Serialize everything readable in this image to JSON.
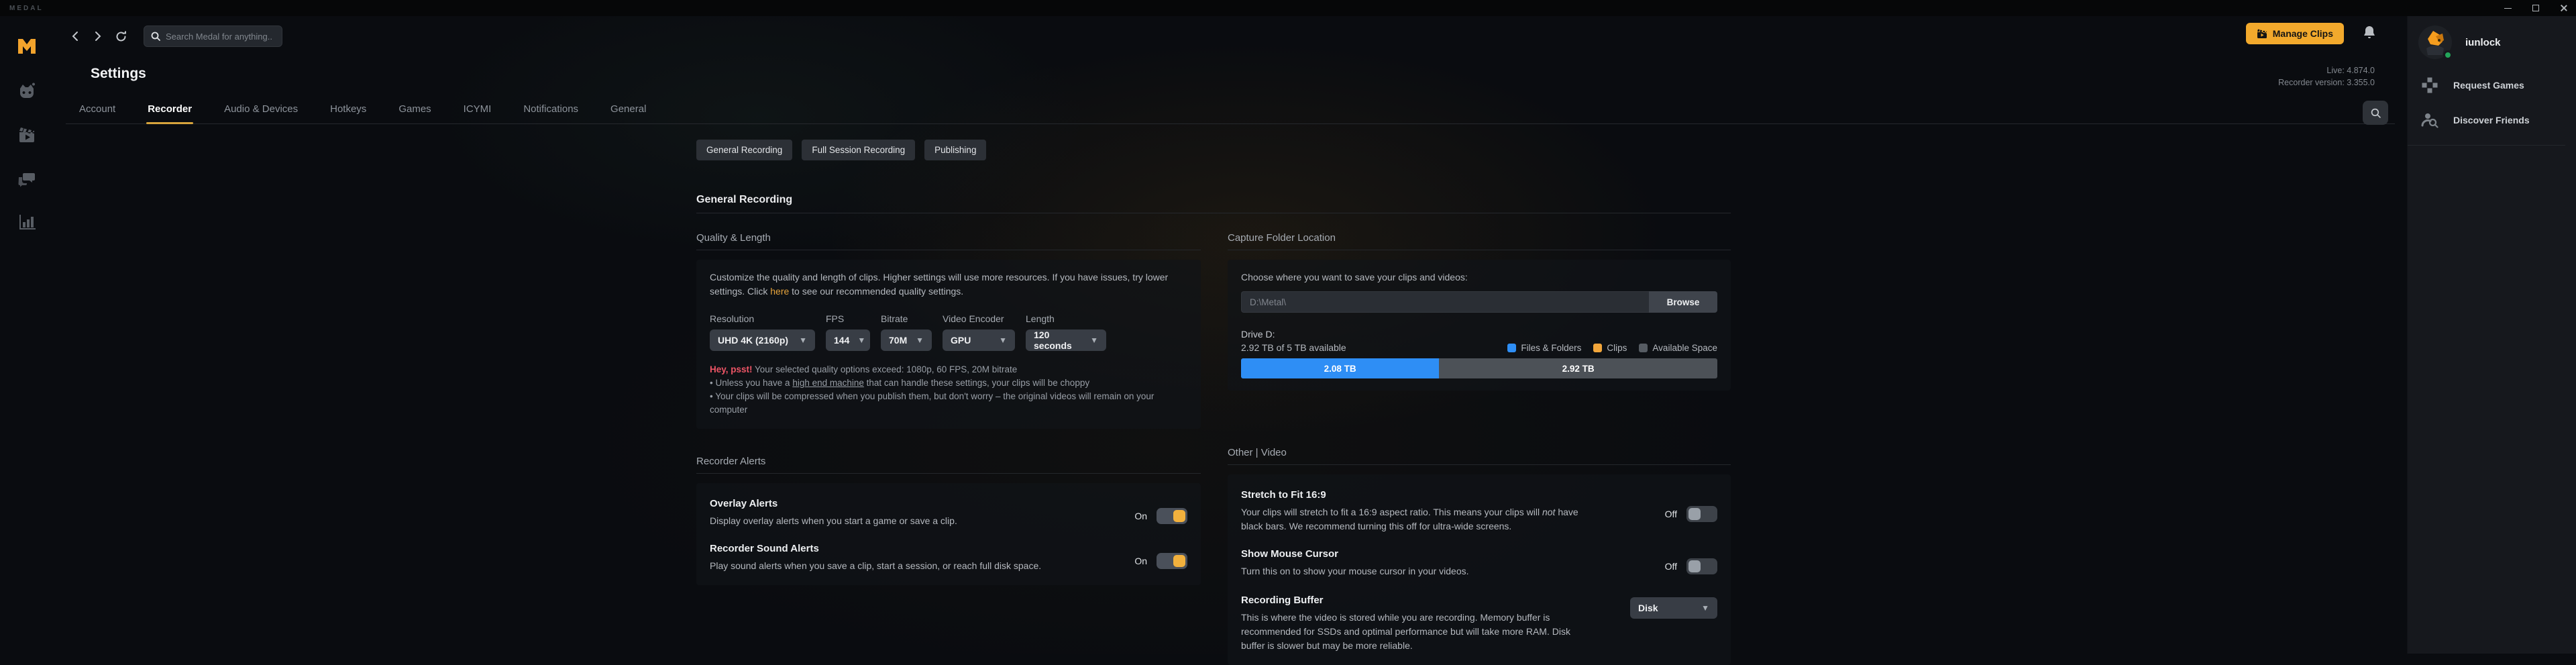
{
  "window": {
    "title": "MEDAL"
  },
  "topbar": {
    "search_placeholder": "Search Medal for anything...",
    "manage_clips_label": "Manage Clips",
    "live_version": "Live: 4.874.0",
    "recorder_version": "Recorder version: 3.355.0"
  },
  "user_panel": {
    "username": "iunlock",
    "request_games": "Request Games",
    "discover_friends": "Discover Friends"
  },
  "settings": {
    "title": "Settings",
    "tabs": [
      {
        "label": "Account"
      },
      {
        "label": "Recorder"
      },
      {
        "label": "Audio & Devices"
      },
      {
        "label": "Hotkeys"
      },
      {
        "label": "Games"
      },
      {
        "label": "ICYMI"
      },
      {
        "label": "Notifications"
      },
      {
        "label": "General"
      }
    ],
    "active_tab": "Recorder"
  },
  "subtabs": [
    {
      "label": "General Recording"
    },
    {
      "label": "Full Session Recording"
    },
    {
      "label": "Publishing"
    }
  ],
  "section_heading": "General Recording",
  "quality": {
    "heading": "Quality & Length",
    "desc_pre": "Customize the quality and length of clips. Higher settings will use more resources. If you have issues, try lower settings. Click ",
    "desc_link": "here",
    "desc_post": " to see our recommended quality settings.",
    "dropdowns": [
      {
        "label": "Resolution",
        "value": "UHD 4K (2160p)"
      },
      {
        "label": "FPS",
        "value": "144"
      },
      {
        "label": "Bitrate",
        "value": "70M"
      },
      {
        "label": "Video Encoder",
        "value": "GPU"
      },
      {
        "label": "Length",
        "value": "120 seconds"
      }
    ],
    "warning": {
      "lead": "Hey, psst!",
      "text": " Your selected quality options exceed: 1080p, 60 FPS, 20M bitrate",
      "bullet1_pre": "Unless you have a ",
      "bullet1_link": "high end machine",
      "bullet1_post": " that can handle these settings, your clips will be choppy",
      "bullet2": "Your clips will be compressed when you publish them, but don't worry – the original videos will remain on your computer"
    }
  },
  "capture": {
    "heading": "Capture Folder Location",
    "choose_label": "Choose where you want to save your clips and videos:",
    "path": "D:\\Metal\\",
    "browse_label": "Browse",
    "drive_label": "Drive D:",
    "available_text": "2.92 TB of 5 TB available",
    "legend": [
      {
        "label": "Files & Folders",
        "color": "#2e8ef5"
      },
      {
        "label": "Clips",
        "color": "#f2a63b"
      },
      {
        "label": "Available Space",
        "color": "#565c63"
      }
    ],
    "bar": {
      "used_label": "2.08 TB",
      "used_percent": 41.6,
      "free_label": "2.92 TB",
      "free_percent": 58.4
    }
  },
  "recorder_alerts": {
    "heading": "Recorder Alerts",
    "overlay": {
      "title": "Overlay Alerts",
      "description": "Display overlay alerts when you start a game or save a clip.",
      "state": "On"
    },
    "sound": {
      "title": "Recorder Sound Alerts",
      "description": "Play sound alerts when you save a clip, start a session, or reach full disk space.",
      "state": "On"
    }
  },
  "other_video": {
    "heading": "Other | Video",
    "stretch": {
      "title": "Stretch to Fit 16:9",
      "desc_pre": "Your clips will stretch to fit a 16:9 aspect ratio. This means your clips will ",
      "desc_italic": "not",
      "desc_post": " have black bars. We recommend turning this off for ultra-wide screens.",
      "state": "Off"
    },
    "cursor": {
      "title": "Show Mouse Cursor",
      "description": "Turn this on to show your mouse cursor in your videos.",
      "state": "Off"
    },
    "buffer": {
      "title": "Recording Buffer",
      "description": "This is where the video is stored while you are recording. Memory buffer is recommended for SSDs and optimal performance but will take more RAM. Disk buffer is slower but may be more reliable.",
      "value": "Disk"
    }
  },
  "icons": {
    "rail": [
      "mascot",
      "clips",
      "chat",
      "stats"
    ],
    "topbar": [
      "back-arrow",
      "forward-arrow",
      "refresh",
      "search",
      "clapperboard",
      "bell"
    ],
    "sidebar": [
      "avatar",
      "gamepad",
      "discover-friends"
    ]
  },
  "colors": {
    "accent_orange": "#f2a92c",
    "toggle_on": "#f2b13d",
    "tab_underline": "#d7a43c",
    "warning_red": "#ee5566",
    "link_orange": "#e5a33c",
    "bar_blue": "#2e8ef5",
    "online_green": "#23a55a"
  }
}
